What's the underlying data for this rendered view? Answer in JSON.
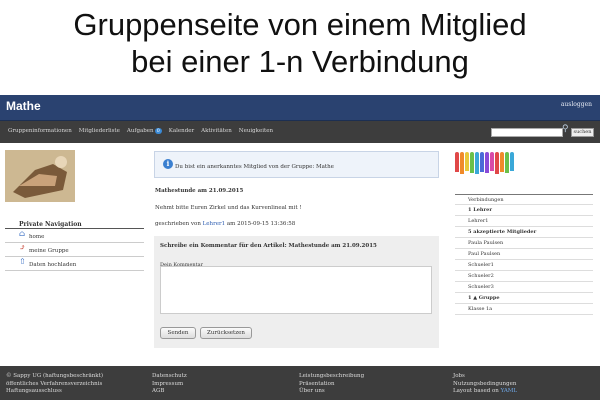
{
  "caption": {
    "line1": "Gruppenseite von einem Mitglied",
    "line2": "bei einer 1-n Verbindung"
  },
  "topbar": {
    "title": "Mathe",
    "logout": "ausloggen"
  },
  "nav": {
    "items": [
      "Gruppeninformationen",
      "Mitgliederliste",
      "Aufgaben",
      "Kalender",
      "Aktivitäten",
      "Neuigkeiten"
    ],
    "tasks_badge": "0",
    "search_button": "suchen"
  },
  "private_nav": {
    "title": "Private Navigation",
    "items": [
      "home",
      "meine Gruppe",
      "Daten hochladen"
    ]
  },
  "notice": {
    "text": "Du bist ein anerkanntes Mitglied von der Gruppe: Mathe"
  },
  "article": {
    "title": "Mathestunde am 21.09.2015",
    "body": "Nehmt bitte Euren Zirkel und das Kurvenlineal mit !",
    "meta_prefix": "geschrieben von ",
    "author": "Lehrer1",
    "meta_suffix": " am 2015-09-15 13:36:58"
  },
  "comment": {
    "title": "Schreibe ein Kommentar für den Artikel: Mathestunde am 21.09.2015",
    "label": "Dein Kommentar",
    "send": "Senden",
    "reset": "Zurücksetzen"
  },
  "connections": {
    "items": [
      {
        "text": "Verbindungen",
        "style": "normal"
      },
      {
        "text": "1 Lehrer",
        "style": "bold"
      },
      {
        "text": "Lehrer1",
        "style": "link"
      },
      {
        "text": "5 akzeptierte Mitglieder",
        "style": "bold"
      },
      {
        "text": "Paula Paulsen",
        "style": "link"
      },
      {
        "text": "Paul Paulsen",
        "style": "link"
      },
      {
        "text": "Schueler1",
        "style": "link"
      },
      {
        "text": "Schueler2",
        "style": "link"
      },
      {
        "text": "Schueler3",
        "style": "link"
      },
      {
        "text": "1 ▲ Gruppe",
        "style": "bold"
      },
      {
        "text": "Klasse 1a",
        "style": "link"
      }
    ]
  },
  "footer": {
    "col1": [
      "© Sappy UG (haftungsbeschränkt)",
      "öffentliches Verfahrensverzeichnis",
      "Haftungsausschluss"
    ],
    "col2": [
      "Datenschutz",
      "Impressum",
      "AGB"
    ],
    "col3": [
      "Leistungsbeschreibung",
      "Präsentation",
      "Über uns"
    ],
    "col4": [
      "Jobs",
      "Nutzungsbedingungen"
    ],
    "col4_last_prefix": "Layout based on ",
    "col4_last_link": "YAML"
  },
  "colors": {
    "topbar": "#2a4270",
    "navbar": "#3d3d3d",
    "footer": "#3d3d3d",
    "link": "#2a5bb0",
    "badge": "#3a8ad6"
  }
}
